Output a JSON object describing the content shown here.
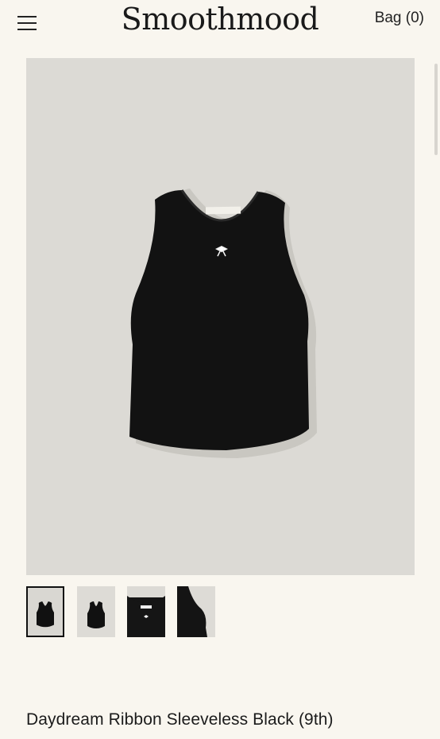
{
  "header": {
    "logo_text": "Smoothmood",
    "bag_label": "Bag (0)",
    "menu_icon": "hamburger-menu-icon"
  },
  "gallery": {
    "selected_index": 0,
    "thumbnails": [
      {
        "alt": "front view"
      },
      {
        "alt": "front view small"
      },
      {
        "alt": "neckline detail"
      },
      {
        "alt": "side detail"
      }
    ]
  },
  "product": {
    "title": "Daydream Ribbon Sleeveless Black (9th)"
  },
  "colors": {
    "background": "#f9f6ef",
    "image_bg": "#dcdad5",
    "garment": "#121212"
  }
}
